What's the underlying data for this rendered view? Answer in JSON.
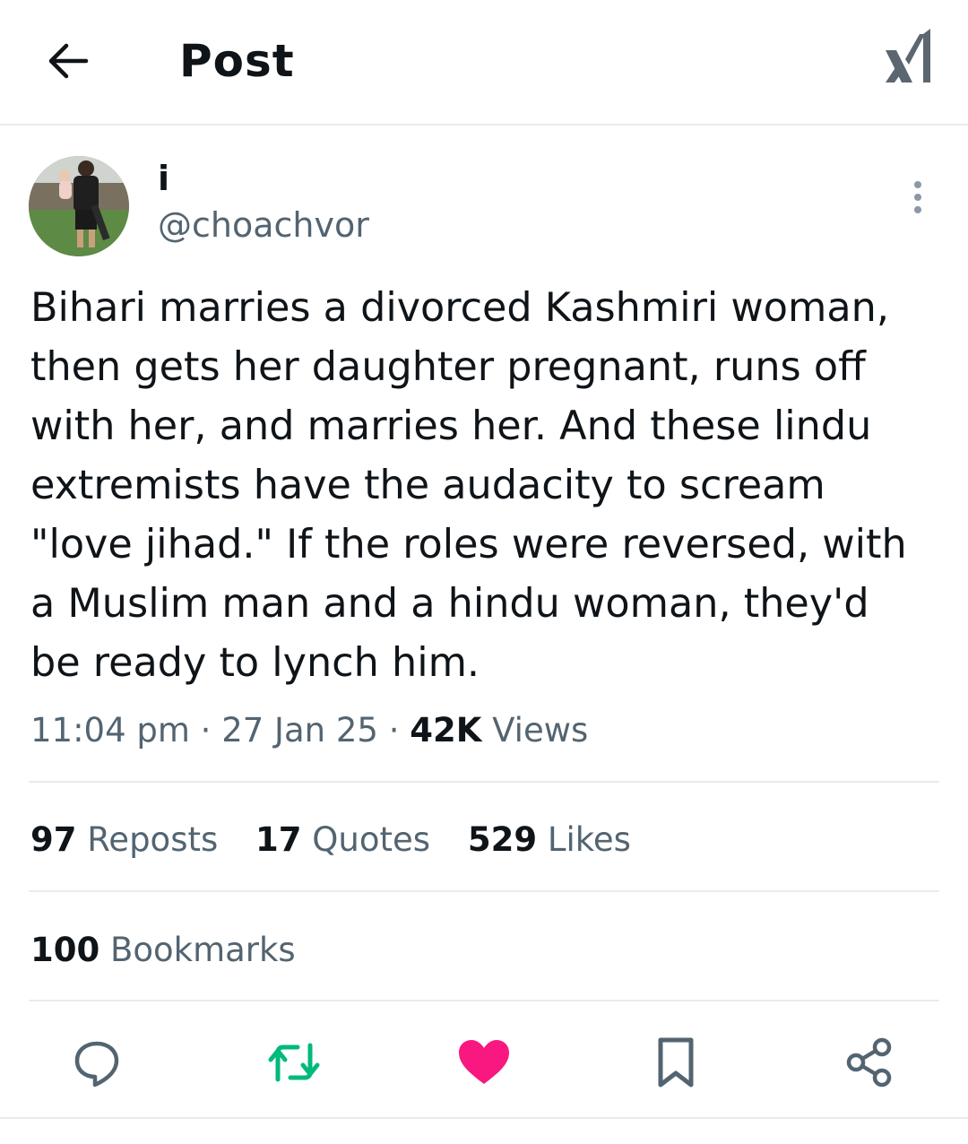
{
  "header": {
    "title": "Post",
    "back_icon": "arrow-left-icon",
    "logo_icon": "x-logo-icon"
  },
  "author": {
    "display_name": "i",
    "handle": "@choachvor"
  },
  "tweet": {
    "text": "Bihari marries a divorced Kashmiri woman,\nthen gets her daughter pregnant, runs off\nwith her, and marries her. And these lindu\nextremists have the audacity to scream\n\"love jihad.\" If the roles were reversed, with\na Muslim man and a hindu woman, they'd\nbe ready to lynch him."
  },
  "meta": {
    "time": "11:04 pm",
    "sep1": " · ",
    "date": "27 Jan 25",
    "sep2": " · ",
    "views_count": "42K",
    "views_label": " Views"
  },
  "stats": {
    "reposts_count": "97",
    "reposts_label": " Reposts",
    "quotes_count": "17",
    "quotes_label": " Quotes",
    "likes_count": "529",
    "likes_label": " Likes",
    "bookmarks_count": "100",
    "bookmarks_label": " Bookmarks"
  },
  "actions": {
    "reply_icon": "reply-icon",
    "repost_icon": "repost-icon",
    "like_icon": "heart-icon",
    "bookmark_icon": "bookmark-icon",
    "share_icon": "share-icon"
  },
  "colors": {
    "text": "#0f1419",
    "secondary": "#536471",
    "divider": "#e6ecf0",
    "repost_green": "#00ba7c",
    "like_pink": "#f91880"
  }
}
